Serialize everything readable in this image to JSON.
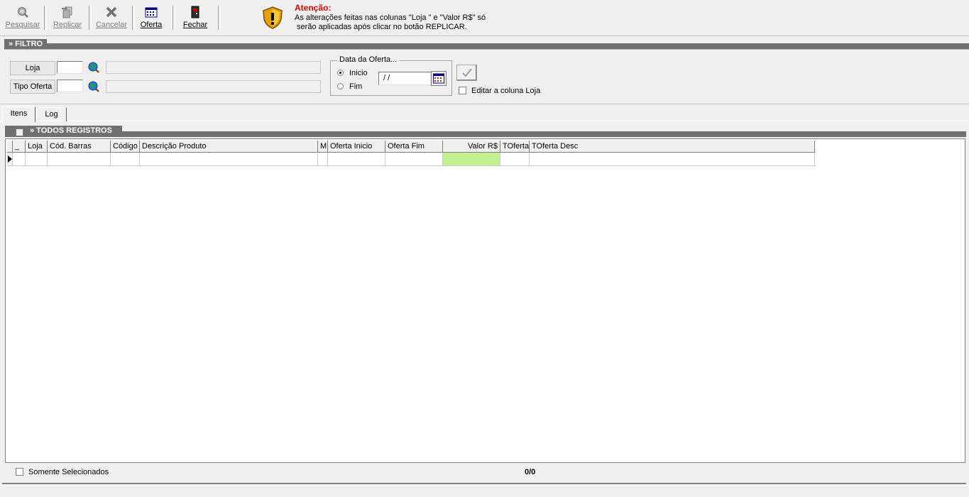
{
  "toolbar": {
    "pesquisar": "Pesquisar",
    "replicar": "Replicar",
    "cancelar": "Cancelar",
    "oferta": "Oferta",
    "fechar": "Fechar"
  },
  "warning": {
    "title": "Atenção:",
    "line1": "As alterações feitas nas colunas \"Loja \" e \"Valor R$\" só",
    "line2": " serão aplicadas após clicar no botão REPLICAR."
  },
  "filtro": {
    "section_title": "» FILTRO",
    "loja_label": "Loja",
    "loja_value": "",
    "tipo_oferta_label": "Tipo Oferta",
    "tipo_oferta_value": "",
    "data_group_title": "Data da Oferta...",
    "radio_inicio": "Inicio",
    "radio_fim": "Fim",
    "selected_radio": "Inicio",
    "date_value": " / /",
    "editar_coluna_loja": "Editar a coluna Loja"
  },
  "tabs": [
    "Itens",
    "Log"
  ],
  "registros": {
    "section_title": "» TODOS REGISTROS"
  },
  "grid": {
    "columns": [
      "_",
      "Loja",
      "Cód. Barras",
      "Código",
      "Descrição Produto",
      "M",
      "Oferta Inicio",
      "Oferta Fim",
      "Valor R$",
      "TOferta",
      "TOferta Desc"
    ],
    "highlight_color": "#c0f090"
  },
  "footer": {
    "somente_selecionados": "Somente Selecionados",
    "counter": "0/0"
  }
}
